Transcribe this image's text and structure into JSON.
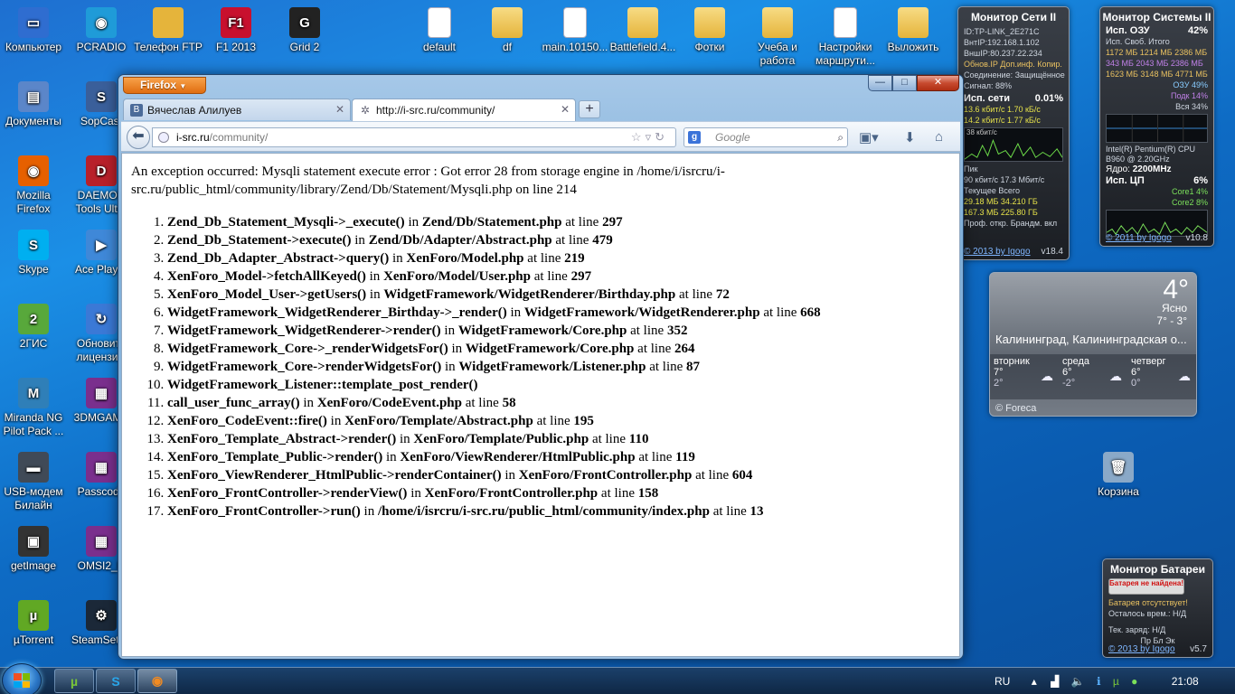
{
  "desktop": {
    "icons": [
      {
        "label": "Компьютер",
        "icon": "computer-icon"
      },
      {
        "label": "PCRADIO",
        "icon": "radio-icon"
      },
      {
        "label": "Телефон FTP",
        "icon": "ftp-folder-icon"
      },
      {
        "label": "F1 2013",
        "icon": "f1-game-icon"
      },
      {
        "label": "Grid 2",
        "icon": "grid-game-icon"
      },
      {
        "label": "default",
        "icon": "file-icon"
      },
      {
        "label": "df",
        "icon": "folder-icon"
      },
      {
        "label": "main.10150...",
        "icon": "file-icon"
      },
      {
        "label": "Battlefield.4...",
        "icon": "folder-icon"
      },
      {
        "label": "Фотки",
        "icon": "folder-icon"
      },
      {
        "label": "Учеба и работа",
        "icon": "folder-icon"
      },
      {
        "label": "Настройки маршрути...",
        "icon": "text-file-icon"
      },
      {
        "label": "Выложить",
        "icon": "folder-icon"
      },
      {
        "label": "Документы",
        "icon": "documents-icon"
      },
      {
        "label": "SopCast",
        "icon": "sopcast-icon"
      },
      {
        "label": "Mozilla Firefox",
        "icon": "firefox-icon"
      },
      {
        "label": "DAEMON Tools Ultra",
        "icon": "daemon-tools-icon"
      },
      {
        "label": "Skype",
        "icon": "skype-icon"
      },
      {
        "label": "Ace Player",
        "icon": "ace-player-icon"
      },
      {
        "label": "2ГИС",
        "icon": "2gis-icon"
      },
      {
        "label": "Обновить лицензию",
        "icon": "update-icon"
      },
      {
        "label": "Miranda NG Pilot Pack ...",
        "icon": "miranda-icon"
      },
      {
        "label": "3DMGAME",
        "icon": "archive-icon"
      },
      {
        "label": "USB-модем Билайн",
        "icon": "usb-modem-icon"
      },
      {
        "label": "Passcode",
        "icon": "archive-icon"
      },
      {
        "label": "getImage",
        "icon": "image-icon"
      },
      {
        "label": "OMSI2_R",
        "icon": "archive-icon"
      },
      {
        "label": "µTorrent",
        "icon": "utorrent-icon"
      },
      {
        "label": "SteamSetup",
        "icon": "steam-icon"
      },
      {
        "label": "Корзина",
        "icon": "recycle-bin-icon"
      }
    ]
  },
  "browser": {
    "app_button": "Firefox",
    "caption": {
      "minimize": "—",
      "maximize": "□",
      "close": "✕"
    },
    "tabs": [
      {
        "title": "Вячеслав Алилуев",
        "favicon": "В",
        "active": false
      },
      {
        "title": "http://i-src.ru/community/",
        "favicon": "✲",
        "active": true
      }
    ],
    "new_tab": "+",
    "url_domain": "i-src.ru",
    "url_path": "/community/",
    "search_engine": "g",
    "search_placeholder": "Google",
    "error_message": "An exception occurred: Mysqli statement execute error : Got error 28 from storage engine in /home/i/isrcru/i-src.ru/public_html/community/library/Zend/Db/Statement/Mysqli.php on line 214",
    "stack_trace": [
      {
        "func": "Zend_Db_Statement_Mysqli->_execute()",
        "file": "Zend/Db/Statement.php",
        "line": "297"
      },
      {
        "func": "Zend_Db_Statement->execute()",
        "file": "Zend/Db/Adapter/Abstract.php",
        "line": "479"
      },
      {
        "func": "Zend_Db_Adapter_Abstract->query()",
        "file": "XenForo/Model.php",
        "line": "219"
      },
      {
        "func": "XenForo_Model->fetchAllKeyed()",
        "file": "XenForo/Model/User.php",
        "line": "297"
      },
      {
        "func": "XenForo_Model_User->getUsers()",
        "file": "WidgetFramework/WidgetRenderer/Birthday.php",
        "line": "72"
      },
      {
        "func": "WidgetFramework_WidgetRenderer_Birthday->_render()",
        "file": "WidgetFramework/WidgetRenderer.php",
        "line": "668"
      },
      {
        "func": "WidgetFramework_WidgetRenderer->render()",
        "file": "WidgetFramework/Core.php",
        "line": "352"
      },
      {
        "func": "WidgetFramework_Core->_renderWidgetsFor()",
        "file": "WidgetFramework/Core.php",
        "line": "264"
      },
      {
        "func": "WidgetFramework_Core->renderWidgetsFor()",
        "file": "WidgetFramework/Listener.php",
        "line": "87"
      },
      {
        "func": "WidgetFramework_Listener::template_post_render()",
        "file": "",
        "line": ""
      },
      {
        "func": "call_user_func_array()",
        "file": "XenForo/CodeEvent.php",
        "line": "58"
      },
      {
        "func": "XenForo_CodeEvent::fire()",
        "file": "XenForo/Template/Abstract.php",
        "line": "195"
      },
      {
        "func": "XenForo_Template_Abstract->render()",
        "file": "XenForo/Template/Public.php",
        "line": "110"
      },
      {
        "func": "XenForo_Template_Public->render()",
        "file": "XenForo/ViewRenderer/HtmlPublic.php",
        "line": "119"
      },
      {
        "func": "XenForo_ViewRenderer_HtmlPublic->renderContainer()",
        "file": "XenForo/FrontController.php",
        "line": "604"
      },
      {
        "func": "XenForo_FrontController->renderView()",
        "file": "XenForo/FrontController.php",
        "line": "158"
      },
      {
        "func": "XenForo_FrontController->run()",
        "file": "/home/i/isrcru/i-src.ru/public_html/community/index.php",
        "line": "13"
      }
    ]
  },
  "net_gadget": {
    "title": "Монитор Сети II",
    "lines": [
      "ID:TP-LINK_2E271C",
      "ВнтIP:192.168.1.102",
      "ВншIP:80.237.22.234",
      "Обнов.IP  Доп.инф.  Копир.",
      "Соединение: Защищённое",
      "Сигнал: 88%"
    ],
    "net_label": "Исп. сети",
    "net_value": "0.01%",
    "speeds": [
      "13.6 кбит/с  1.70 кБ/с",
      "14.2 кбит/с  1.77 кБ/с"
    ],
    "graph_label": "38 кбит/с",
    "bottom_lines": [
      "Пик",
      "90 кбит/с     17.3 Мбит/с",
      "Текущее    Всего",
      "29.18 МБ    34.210 ГБ",
      "167.3 МБ    225.80 ГБ",
      "Проф. откр.   Брандм. вкл"
    ],
    "footer_link": "© 2013 by Igogo",
    "version": "v18.4"
  },
  "sys_gadget": {
    "title": "Монитор Системы II",
    "ram_label": "Исп. ОЗУ",
    "ram_value": "42%",
    "mem_header": "Исп.    Своб.    Итого",
    "mem_lines": [
      "1172 МБ  1214 МБ  2386 МБ",
      "343 МБ   2043 МБ  2386 МБ",
      "1623 МБ  3148 МБ  4771 МБ"
    ],
    "bars": [
      "ОЗУ 49%",
      "Подк 14%",
      "Вся 34%"
    ],
    "cpu_name": "Intel(R) Pentium(R) CPU B960 @ 2.20GHz",
    "cores_label": "Ядро:",
    "freq": "2200MHz",
    "cpu_label": "Исп. ЦП",
    "cpu_value": "6%",
    "core1": "Core1 4%",
    "core2": "Core2 8%",
    "footer_link": "© 2011 by Igogo",
    "version": "v10.8"
  },
  "weather": {
    "temp": "4°",
    "condition": "Ясно",
    "range": "7° - 3°",
    "city": "Калининград, Калининградская о...",
    "days": [
      {
        "name": "вторник",
        "hi": "7°",
        "lo": "2°"
      },
      {
        "name": "среда",
        "hi": "6°",
        "lo": "-2°"
      },
      {
        "name": "четверг",
        "hi": "6°",
        "lo": "0°"
      }
    ],
    "provider": "© Foreca"
  },
  "battery_gadget": {
    "title": "Монитор Батареи",
    "alert": "Батарея не найдена!",
    "status": "Батарея отсутствует!",
    "remaining": "Осталось врем.: Н/Д",
    "charge": "Тек. заряд: Н/Д",
    "modes": "Пр  Бл  Эк",
    "footer_link": "© 2013 by Igogo",
    "version": "v5.7"
  },
  "taskbar": {
    "pinned": [
      "utorrent-icon",
      "skype-icon",
      "firefox-icon"
    ],
    "language": "RU",
    "clock": "21:08"
  }
}
